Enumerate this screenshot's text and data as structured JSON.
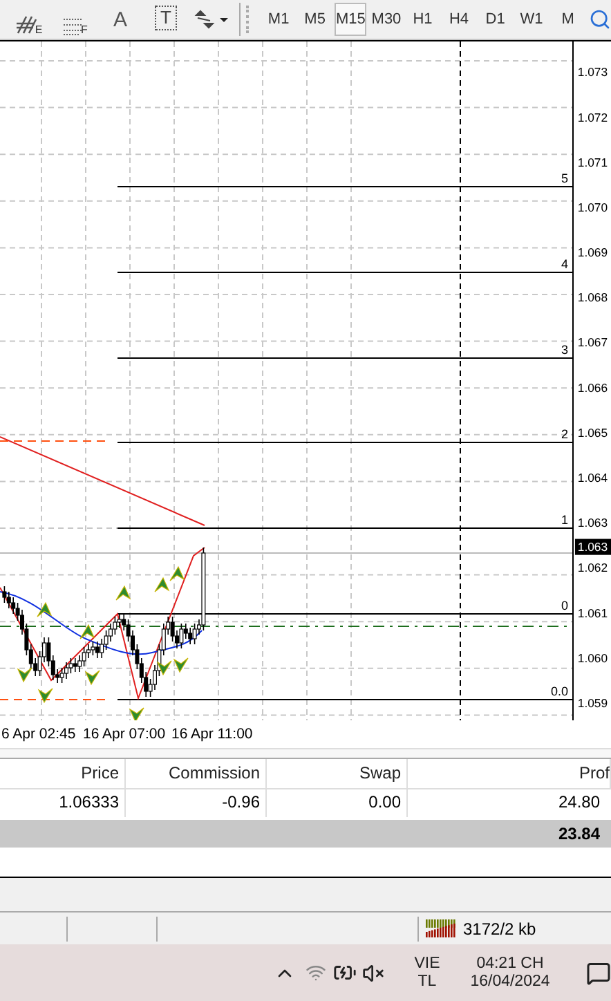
{
  "toolbar": {
    "tools": [
      {
        "kind": "channel",
        "sub": "E"
      },
      {
        "kind": "fibo",
        "sub": "F"
      },
      {
        "kind": "text",
        "label": "A"
      },
      {
        "kind": "textbox",
        "label": "T"
      },
      {
        "kind": "arrows"
      }
    ],
    "periods": [
      {
        "label": "M1",
        "selected": false
      },
      {
        "label": "M5",
        "selected": false
      },
      {
        "label": "M15",
        "selected": true
      },
      {
        "label": "M30",
        "selected": false
      },
      {
        "label": "H1",
        "selected": false
      },
      {
        "label": "H4",
        "selected": false
      },
      {
        "label": "D1",
        "selected": false
      },
      {
        "label": "W1",
        "selected": false
      },
      {
        "label": "M",
        "selected": false
      }
    ]
  },
  "chart": {
    "price_labels": [
      "1.073",
      "1.072",
      "1.071",
      "1.070",
      "1.069",
      "1.068",
      "1.067",
      "1.066",
      "1.065",
      "1.064",
      "1.063",
      "1.062",
      "1.061",
      "1.060",
      "1.059"
    ],
    "current_price": "1.063",
    "fib_levels": [
      "5",
      "4",
      "3",
      "2",
      "1",
      "0",
      "0.0"
    ],
    "time_labels": [
      "6 Apr 02:45",
      "16 Apr 07:00",
      "16 Apr 11:00"
    ]
  },
  "table": {
    "columns": [
      "Price",
      "Commission",
      "Swap",
      "Prof"
    ],
    "rows": [
      [
        "1.06333",
        "-0.96",
        "0.00",
        "24.80"
      ]
    ],
    "total": "23.84"
  },
  "status_bar": {
    "traffic": "3172/2 kb"
  },
  "taskbar": {
    "day": "VIE",
    "month": "TL",
    "time": "04:21 CH",
    "date": "16/04/2024"
  }
}
